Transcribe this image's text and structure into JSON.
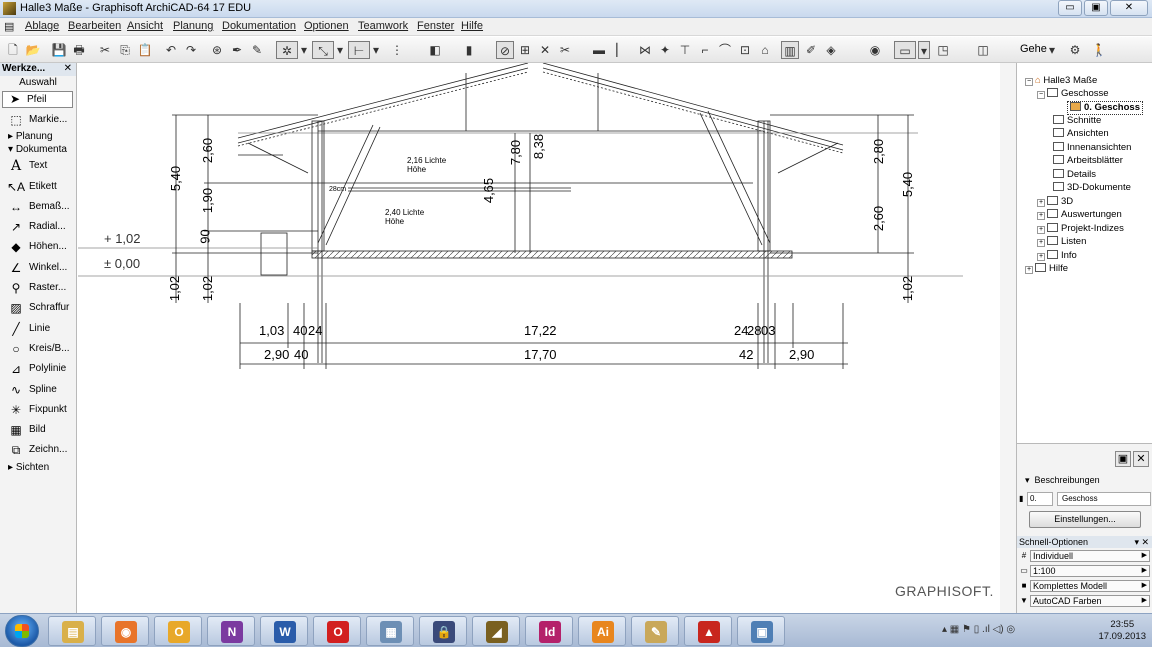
{
  "window": {
    "title": "Halle3 Maße - Graphisoft ArchiCAD-64 17 EDU"
  },
  "menu": [
    "Ablage",
    "Bearbeiten",
    "Ansicht",
    "Planung",
    "Dokumentation",
    "Optionen",
    "Teamwork",
    "Fenster",
    "Hilfe"
  ],
  "toolbar": {
    "goto_label": "Gehe"
  },
  "toolbox": {
    "title": "Werkze...",
    "selection_label": "Auswahl",
    "tools": [
      {
        "label": "Pfeil",
        "icon": "arrow-icon"
      },
      {
        "label": "Markie...",
        "icon": "marquee-icon"
      }
    ],
    "group_planung": "Planung",
    "group_doku": "Dokumenta",
    "doc_tools": [
      {
        "label": "Text",
        "icon": "text-icon"
      },
      {
        "label": "Etikett",
        "icon": "label-icon"
      },
      {
        "label": "Bemaß...",
        "icon": "dimension-icon"
      },
      {
        "label": "Radial...",
        "icon": "radial-dimension-icon"
      },
      {
        "label": "Höhen...",
        "icon": "level-dimension-icon"
      },
      {
        "label": "Winkel...",
        "icon": "angle-dimension-icon"
      },
      {
        "label": "Raster...",
        "icon": "grid-icon"
      },
      {
        "label": "Schraffur",
        "icon": "fill-icon"
      },
      {
        "label": "Linie",
        "icon": "line-icon"
      },
      {
        "label": "Kreis/B...",
        "icon": "circle-icon"
      },
      {
        "label": "Polylinie",
        "icon": "polyline-icon"
      },
      {
        "label": "Spline",
        "icon": "spline-icon"
      },
      {
        "label": "Fixpunkt",
        "icon": "hotspot-icon"
      },
      {
        "label": "Bild",
        "icon": "image-icon"
      },
      {
        "label": "Zeichn...",
        "icon": "drawing-icon"
      }
    ],
    "group_sichten": "Sichten"
  },
  "drawing": {
    "level_plus": "+ 1,02",
    "level_zero": "± 0,00",
    "left_dims": [
      "5,40",
      "2,60",
      "1,90",
      "90",
      "1,02",
      "1,02"
    ],
    "right_dims": [
      "2,80",
      "5,40",
      "2,60",
      "1,02"
    ],
    "mid_dims": [
      "7,80",
      "8,38",
      "4,65"
    ],
    "room1_line1": "2,16 Lichte",
    "room1_line2": "Höhe",
    "room2_line1": "2,40 Lichte",
    "room2_line2": "Höhe",
    "small_dim": "28cm",
    "row1": [
      "1,03",
      "40",
      "24",
      "17,22",
      "24",
      "28",
      "03"
    ],
    "row2": [
      "2,90",
      "40",
      "17,70",
      "42",
      "2,90"
    ],
    "watermark": "GRAPHISOFT."
  },
  "navigator": {
    "root": "Halle3 Maße",
    "stories": "Geschosse",
    "current_story": "0. Geschoss",
    "items": [
      "Schnitte",
      "Ansichten",
      "Innenansichten",
      "Arbeitsblätter",
      "Details",
      "3D-Dokumente",
      "3D",
      "Auswertungen",
      "Projekt-Indizes",
      "Listen",
      "Info",
      "Hilfe"
    ]
  },
  "properties": {
    "descriptions_label": "Beschreibungen",
    "story_number": "0.",
    "story_name": "Geschoss",
    "settings_button": "Einstellungen..."
  },
  "quick_options": {
    "title": "Schnell-Optionen",
    "rows": [
      {
        "icon": "#",
        "value": "Individuell"
      },
      {
        "icon": "▭",
        "value": "1:100"
      },
      {
        "icon": "■",
        "value": "Komplettes Modell"
      },
      {
        "icon": "▼",
        "value": "AutoCAD Farben"
      }
    ]
  },
  "taskbar": {
    "apps": [
      {
        "name": "explorer-icon",
        "color": "#d9b04a",
        "glyph": "▤"
      },
      {
        "name": "firefox-icon",
        "color": "#e8742a",
        "glyph": "◉"
      },
      {
        "name": "outlook-icon",
        "color": "#e8a82a",
        "glyph": "O"
      },
      {
        "name": "onenote-icon",
        "color": "#7b3aa0",
        "glyph": "N"
      },
      {
        "name": "word-icon",
        "color": "#2a5caa",
        "glyph": "W"
      },
      {
        "name": "opera-icon",
        "color": "#d21f1f",
        "glyph": "O"
      },
      {
        "name": "calculator-icon",
        "color": "#6d8fb5",
        "glyph": "▦"
      },
      {
        "name": "keepass-icon",
        "color": "#3a4a7a",
        "glyph": "🔒"
      },
      {
        "name": "archicad-icon",
        "color": "#7a6020",
        "glyph": "◢"
      },
      {
        "name": "indesign-icon",
        "color": "#b4216a",
        "glyph": "Id"
      },
      {
        "name": "illustrator-icon",
        "color": "#e8861e",
        "glyph": "Ai"
      },
      {
        "name": "notepad-icon",
        "color": "#c9a85a",
        "glyph": "✎"
      },
      {
        "name": "autocad-icon",
        "color": "#c8261e",
        "glyph": "▲"
      },
      {
        "name": "remote-icon",
        "color": "#4f7fb5",
        "glyph": "▣"
      }
    ],
    "time": "23:55",
    "date": "17.09.2013"
  }
}
